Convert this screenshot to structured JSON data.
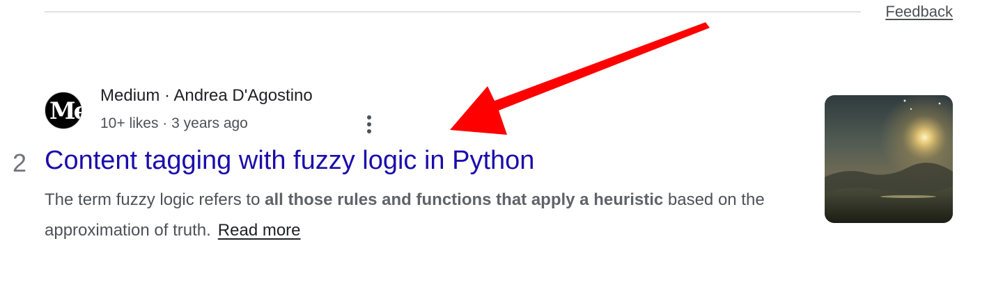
{
  "header": {
    "feedback_label": "Feedback"
  },
  "result": {
    "rank": "2",
    "favicon_text": "Me",
    "source_line": "Medium · Andrea D'Agostino",
    "meta_line": "10+ likes · 3 years ago",
    "title": "Content tagging with fuzzy logic in Python",
    "snippet_plain_1": "The term fuzzy logic refers to ",
    "snippet_bold": "all those rules and functions that apply a heuristic",
    "snippet_plain_2": " based on the approximation of truth.",
    "read_more_label": "Read more",
    "thumbnail_icon": "sunset-landscape-thumbnail",
    "menu_icon": "more-vert-icon"
  },
  "annotation": {
    "arrow_color": "#ff0000",
    "arrow_icon": "red-arrow-annotation"
  },
  "colors": {
    "title_link": "#1a0dab",
    "text": "#4d5156",
    "heading_text": "#202124"
  }
}
